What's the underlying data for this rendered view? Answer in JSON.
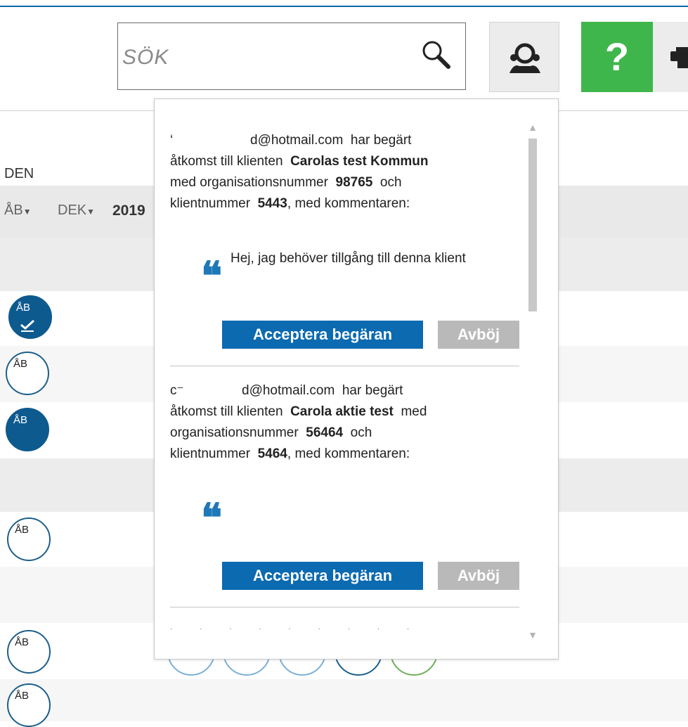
{
  "header": {
    "search_placeholder": "SÖK",
    "help_label": "?",
    "icons": {
      "search": "magnifier-icon",
      "support": "support-people-icon",
      "printer": "printer-icon"
    },
    "colors": {
      "accent_blue": "#0b68a8",
      "help_green": "#3fb64b"
    }
  },
  "table": {
    "column_label": "DEN",
    "filters": [
      {
        "label": "ÅB"
      },
      {
        "label": "DEK"
      }
    ],
    "year": "2019",
    "badge_label": "ÅB"
  },
  "popup": {
    "requests": [
      {
        "email": "d@hotmail.com",
        "text_requested": "har begärt",
        "text_access": "åtkomst till klienten",
        "client": "Carolas test Kommun",
        "text_org": "med organisationsnummer",
        "org_number": "98765",
        "text_and": "och",
        "text_clientnumber": "klientnummer",
        "client_number": "5443",
        "text_comment": ", med kommentaren:",
        "comment": "Hej, jag behöver tillgång till denna klient",
        "accept_label": "Acceptera begäran",
        "decline_label": "Avböj"
      },
      {
        "email": "d@hotmail.com",
        "text_requested": "har begärt",
        "text_access": "åtkomst till klienten",
        "client": "Carola aktie test",
        "text_med": "med",
        "text_org": "organisationsnummer",
        "org_number": "56464",
        "text_and": "och",
        "text_clientnumber": "klientnummer",
        "client_number": "5464",
        "text_comment": ", med kommentaren:",
        "comment": "",
        "accept_label": "Acceptera begäran",
        "decline_label": "Avböj"
      }
    ],
    "quote_glyph": "❝"
  }
}
